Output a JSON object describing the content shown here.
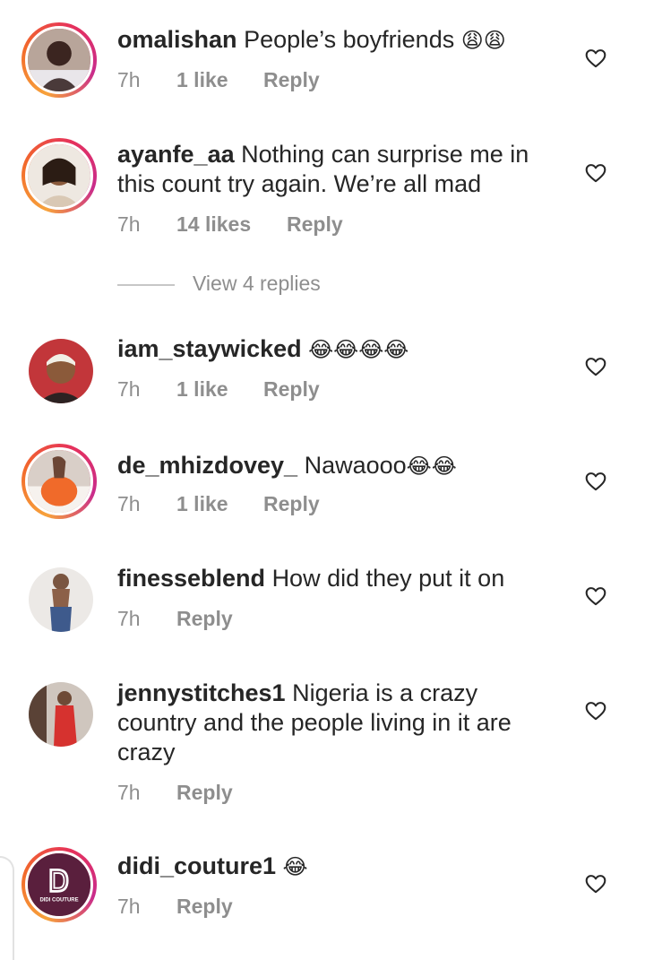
{
  "comments": [
    {
      "username": "omalishan",
      "text": "People’s boyfriends",
      "emoji": "😩😩",
      "time": "7h",
      "likes": "1 like",
      "reply": "Reply"
    },
    {
      "username": "ayanfe_aa",
      "text": "Nothing can surprise me in this count try again. We’re all mad",
      "emoji": "",
      "time": "7h",
      "likes": "14 likes",
      "reply": "Reply"
    },
    {
      "username": "iam_staywicked",
      "text": "",
      "emoji": "😂😂😂😂",
      "time": "7h",
      "likes": "1 like",
      "reply": "Reply"
    },
    {
      "username": "de_mhizdovey_",
      "text": "Nawaooo",
      "emoji": "😂😂",
      "time": "7h",
      "likes": "1 like",
      "reply": "Reply"
    },
    {
      "username": "finesseblend",
      "text": "How did they put it on",
      "emoji": "",
      "time": "7h",
      "likes": "",
      "reply": "Reply"
    },
    {
      "username": "jennystitches1",
      "text": "Nigeria is a crazy country and the people living in it are crazy",
      "emoji": "",
      "time": "7h",
      "likes": "",
      "reply": "Reply"
    },
    {
      "username": "didi_couture1",
      "text": "",
      "emoji": "😂",
      "time": "7h",
      "likes": "",
      "reply": "Reply"
    }
  ],
  "view_replies": "View 4 replies",
  "logo_text": "DIDI COUTURE",
  "colors": {
    "text": "#262626",
    "muted": "#8e8e8e",
    "story_ring": [
      "#f7a23b",
      "#e6315b",
      "#c92b8c"
    ]
  }
}
